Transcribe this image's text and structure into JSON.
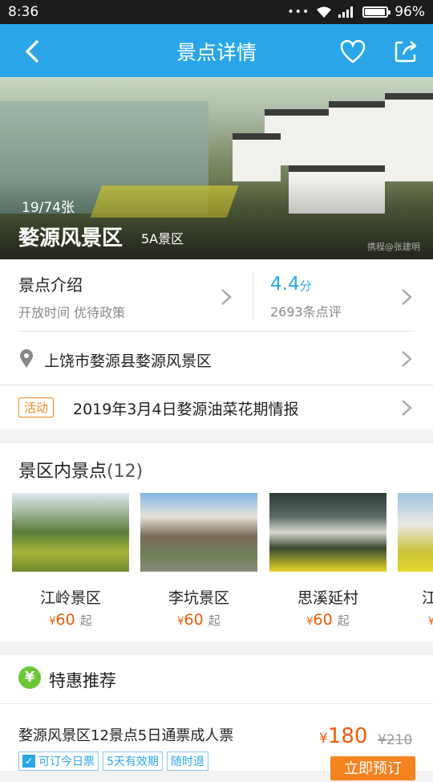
{
  "status_bar": {
    "time": "8:36",
    "battery": "96%",
    "battery_level": 0.96
  },
  "header": {
    "title": "景点详情"
  },
  "hero": {
    "counter": "19/74张",
    "name": "婺源风景区",
    "level": "5A景区",
    "watermark": "携程@张建明"
  },
  "intro": {
    "title": "景点介绍",
    "subtitle": "开放时间  优待政策"
  },
  "rating": {
    "score": "4.4",
    "unit": "分",
    "reviews": "2693条点评"
  },
  "address": "上饶市婺源县婺源风景区",
  "activity": {
    "tag": "活动",
    "text": "2019年3月4日婺源油菜花期情报"
  },
  "spots": {
    "title": "景区内景点",
    "count": "(12)",
    "currency": "¥",
    "suffix": "起",
    "items": [
      {
        "name": "江岭景区",
        "price": "60"
      },
      {
        "name": "李坑景区",
        "price": "60"
      },
      {
        "name": "思溪延村",
        "price": "60"
      },
      {
        "name": "江",
        "price": ""
      }
    ]
  },
  "deals": {
    "title": "特惠推荐",
    "yen_icon": "¥",
    "product": "婺源风景区12景点5日通票成人票",
    "currency": "¥",
    "price": "180",
    "original": "¥210",
    "chips": [
      "可订今日票",
      "5天有效期",
      "随时退"
    ],
    "book": "立即预订"
  }
}
